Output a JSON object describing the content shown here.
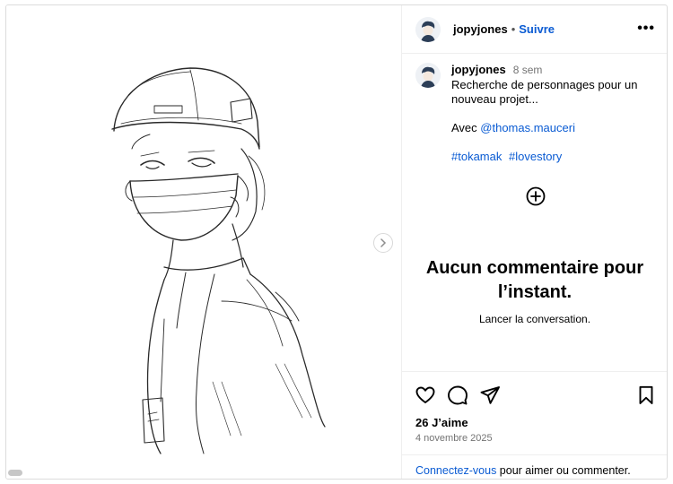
{
  "header": {
    "username": "jopyjones",
    "separator": "•",
    "follow_label": "Suivre",
    "more_icon": "more-dots-icon"
  },
  "caption": {
    "username": "jopyjones",
    "time": "8 sem",
    "line1": "Recherche de personnages pour un nouveau projet...",
    "avec": "Avec ",
    "mention": "@thomas.mauceri",
    "hashtags": [
      "#tokamak",
      "#lovestory"
    ]
  },
  "load_more_icon": "plus-circle-icon",
  "empty": {
    "title": "Aucun commentaire pour l’instant.",
    "subtitle": "Lancer la conversation."
  },
  "actions": {
    "icons": [
      "heart-icon",
      "comment-icon",
      "share-icon",
      "bookmark-icon"
    ],
    "likes": "26 J’aime",
    "date": "4 novembre 2025",
    "login_link": "Connectez-vous",
    "login_rest": " pour aimer ou commenter."
  },
  "media": {
    "next_icon": "chevron-right-icon",
    "image": "pencil-sketch-person-hard-hat-mask"
  },
  "colors": {
    "link": "#0a5bd3",
    "muted": "#737373",
    "border": "#dbdbdb"
  }
}
